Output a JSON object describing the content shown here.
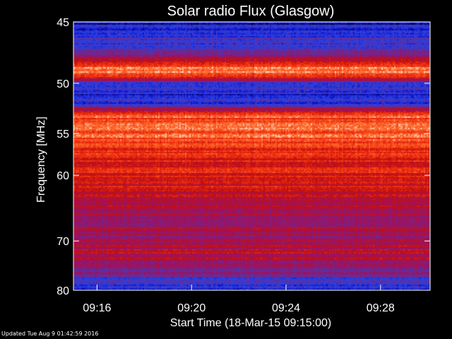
{
  "updated": "Updated Tue Aug  9 01:42:59 2016",
  "chart_data": {
    "type": "heatmap",
    "title": "Solar radio Flux (Glasgow)",
    "xlabel": "Start Time (18-Mar-15 09:15:00)",
    "ylabel": "Frequency [MHz]",
    "x_ticks": [
      "09:16",
      "09:20",
      "09:24",
      "09:28"
    ],
    "x_tick_minutes": [
      16,
      20,
      24,
      28
    ],
    "xlim_minutes": [
      15,
      30.1
    ],
    "y_ticks": [
      45,
      50,
      55,
      60,
      70,
      80
    ],
    "ylim": [
      45,
      80
    ],
    "y_scale": "reciprocal (reversed, 45 at top)",
    "colormap": [
      "#000000",
      "#1010c8",
      "#2a40e0",
      "#6a2a90",
      "#a01060",
      "#c01010",
      "#f03010",
      "#ff7030",
      "#ffffff"
    ],
    "spectrum_profile": [
      {
        "freq_mhz": 45.0,
        "level": 0.15
      },
      {
        "freq_mhz": 46.0,
        "level": 0.25
      },
      {
        "freq_mhz": 47.0,
        "level": 0.32
      },
      {
        "freq_mhz": 48.0,
        "level": 0.55
      },
      {
        "freq_mhz": 49.0,
        "level": 0.97
      },
      {
        "freq_mhz": 50.0,
        "level": 0.3
      },
      {
        "freq_mhz": 51.0,
        "level": 0.2
      },
      {
        "freq_mhz": 52.0,
        "level": 0.25
      },
      {
        "freq_mhz": 53.0,
        "level": 0.8
      },
      {
        "freq_mhz": 55.0,
        "level": 0.82
      },
      {
        "freq_mhz": 57.0,
        "level": 0.7
      },
      {
        "freq_mhz": 60.0,
        "level": 0.68
      },
      {
        "freq_mhz": 63.0,
        "level": 0.6
      },
      {
        "freq_mhz": 66.0,
        "level": 0.5
      },
      {
        "freq_mhz": 70.0,
        "level": 0.52
      },
      {
        "freq_mhz": 72.0,
        "level": 0.58
      },
      {
        "freq_mhz": 74.0,
        "level": 0.5
      },
      {
        "freq_mhz": 77.0,
        "level": 0.35
      },
      {
        "freq_mhz": 80.0,
        "level": 0.2
      }
    ]
  }
}
